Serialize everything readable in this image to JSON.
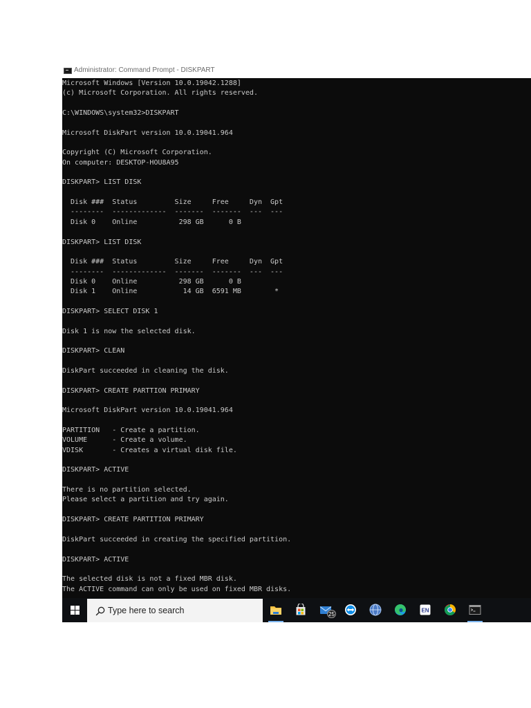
{
  "window": {
    "title": "Administrator: Command Prompt - DISKPART"
  },
  "console": {
    "lines": [
      "Microsoft Windows [Version 10.0.19042.1288]",
      "(c) Microsoft Corporation. All rights reserved.",
      "",
      "C:\\WINDOWS\\system32>DISKPART",
      "",
      "Microsoft DiskPart version 10.0.19041.964",
      "",
      "Copyright (C) Microsoft Corporation.",
      "On computer: DESKTOP-HOU8A95",
      "",
      "DISKPART> LIST DISK",
      "",
      "  Disk ###  Status         Size     Free     Dyn  Gpt",
      "  --------  -------------  -------  -------  ---  ---",
      "  Disk 0    Online          298 GB      0 B",
      "",
      "DISKPART> LIST DISK",
      "",
      "  Disk ###  Status         Size     Free     Dyn  Gpt",
      "  --------  -------------  -------  -------  ---  ---",
      "  Disk 0    Online          298 GB      0 B",
      "  Disk 1    Online           14 GB  6591 MB        *",
      "",
      "DISKPART> SELECT DISK 1",
      "",
      "Disk 1 is now the selected disk.",
      "",
      "DISKPART> CLEAN",
      "",
      "DiskPart succeeded in cleaning the disk.",
      "",
      "DISKPART> CREATE PARTTION PRIMARY",
      "",
      "Microsoft DiskPart version 10.0.19041.964",
      "",
      "PARTITION   - Create a partition.",
      "VOLUME      - Create a volume.",
      "VDISK       - Creates a virtual disk file.",
      "",
      "DISKPART> ACTIVE",
      "",
      "There is no partition selected.",
      "Please select a partition and try again.",
      "",
      "DISKPART> CREATE PARTITION PRIMARY",
      "",
      "DiskPart succeeded in creating the specified partition.",
      "",
      "DISKPART> ACTIVE",
      "",
      "The selected disk is not a fixed MBR disk.",
      "The ACTIVE command can only be used on fixed MBR disks."
    ]
  },
  "taskbar": {
    "search_placeholder": "Type here to search",
    "mail_badge": "25",
    "language_label": "EN",
    "apps": [
      {
        "name": "file-explorer",
        "active": true
      },
      {
        "name": "microsoft-store",
        "active": false
      },
      {
        "name": "mail",
        "active": false
      },
      {
        "name": "teamviewer",
        "active": false
      },
      {
        "name": "app-blue-globe",
        "active": false
      },
      {
        "name": "microsoft-edge",
        "active": false
      },
      {
        "name": "language-en",
        "active": false
      },
      {
        "name": "google-chrome",
        "active": false
      },
      {
        "name": "command-prompt",
        "active": true
      }
    ]
  },
  "colors": {
    "console_bg": "#0c0c0c",
    "console_text": "#cccccc",
    "taskbar_bg": "#0e1013",
    "accent": "#7ab4f0"
  }
}
